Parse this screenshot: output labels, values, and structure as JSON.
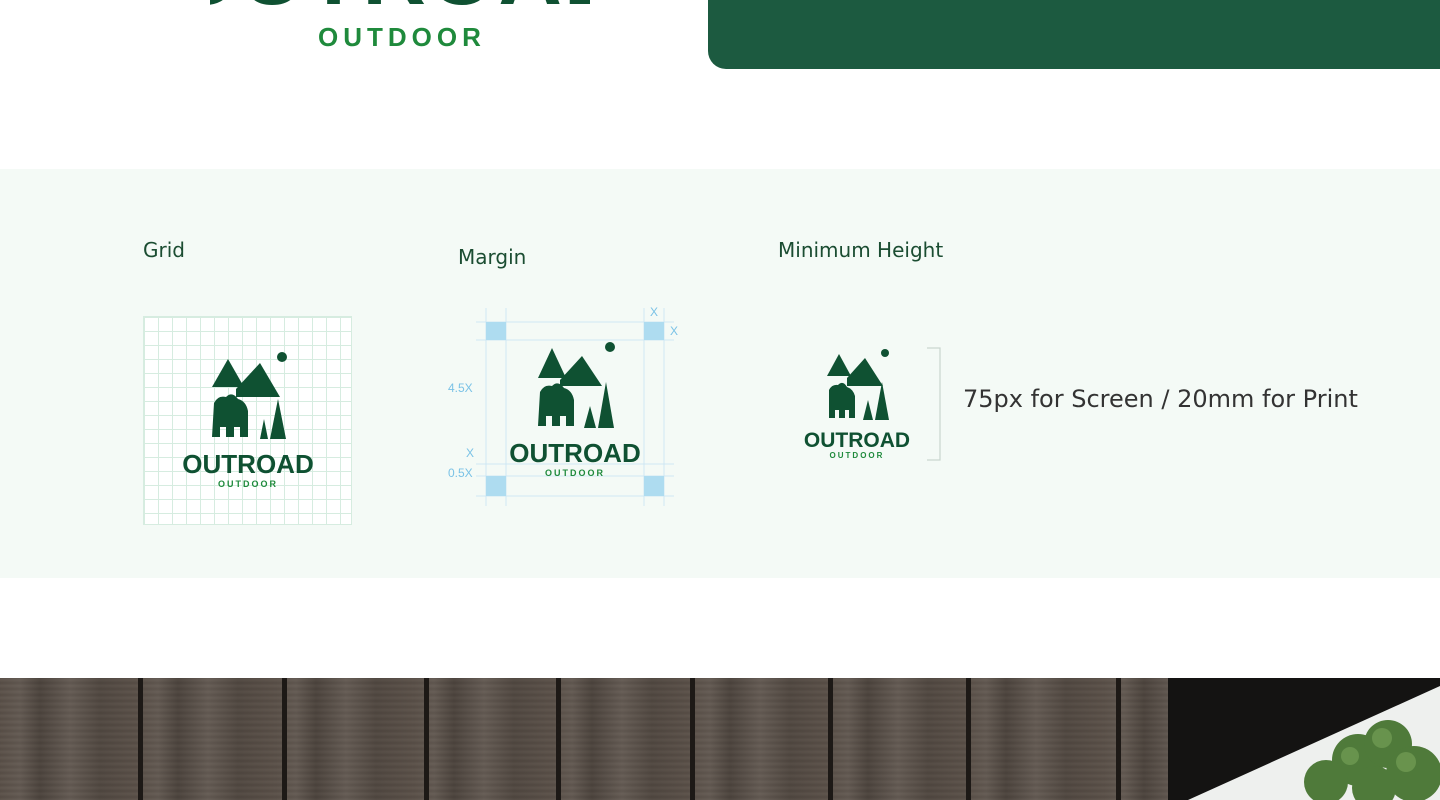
{
  "hero": {
    "wordmark": "OUTROAD",
    "subtitle": "OUTDOOR"
  },
  "guidelines": {
    "grid_label": "Grid",
    "margin_label": "Margin",
    "min_height_label": "Minimum Height",
    "min_height_text": "75px for Screen / 20mm for Print",
    "margin_marks": {
      "x_top": "X",
      "x_right": "X",
      "four_point_five": "4.5X",
      "x_lower": "X",
      "half": "0.5X"
    }
  },
  "logo": {
    "wordmark": "OUTROAD",
    "subtitle": "OUTDOOR"
  },
  "colors": {
    "brand_dark": "#1c5a40",
    "brand_green": "#1f8a3c",
    "logo_green": "#0f5132",
    "band_bg": "#f4faf6",
    "guide_blue": "#aedcf0",
    "guide_text": "#7ac2e6"
  }
}
